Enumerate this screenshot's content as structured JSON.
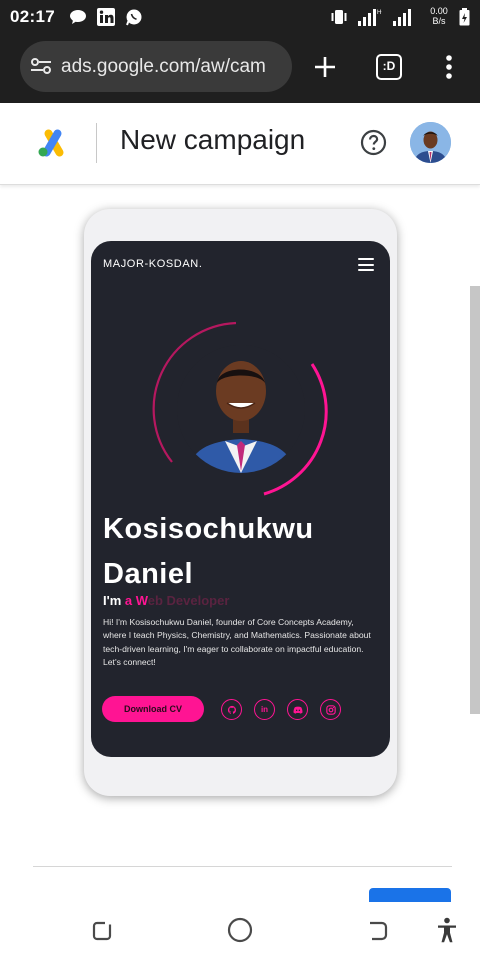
{
  "status_bar": {
    "time": "02:17",
    "net_speed_value": "0.00",
    "net_speed_unit": "B/s",
    "notification_icons": [
      "chat-bubble-icon",
      "linkedin-icon",
      "whatsapp-icon"
    ],
    "system_icons": [
      "vibrate-icon",
      "signal-icon",
      "signal-icon",
      "battery-icon"
    ]
  },
  "browser": {
    "url": "ads.google.com/aw/cam",
    "tab_count_label": ":D"
  },
  "header": {
    "title": "New campaign"
  },
  "preview": {
    "brand": "MAJOR-KOSDAN.",
    "name_line1": "Kosisochukwu",
    "name_line2": "Daniel",
    "tagline_prefix": "I'm ",
    "tagline_highlight": "a W",
    "tagline_faded": "eb Developer",
    "bio": "Hi! I'm Kosisochukwu Daniel, founder of Core Concepts Academy, where I teach Physics, Chemistry, and Mathematics. Passionate about tech-driven learning, I'm eager to collaborate on impactful education. Let's connect!",
    "cv_button": "Download CV",
    "social_icons": [
      "github-icon",
      "linkedin-icon",
      "discord-icon",
      "instagram-icon"
    ],
    "social_labels": [
      "",
      "in",
      "",
      ""
    ],
    "accent_color": "#ff1493"
  }
}
